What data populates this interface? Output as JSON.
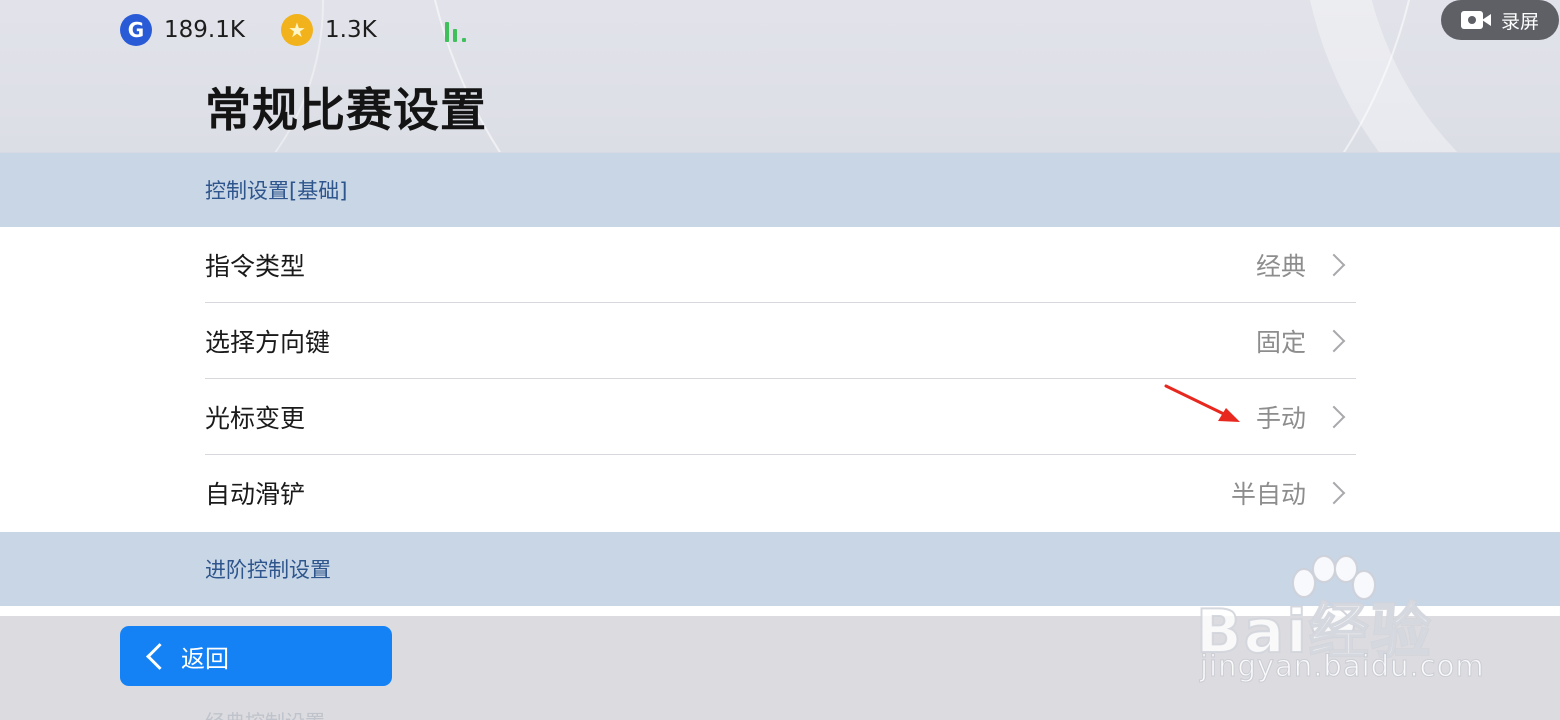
{
  "status_bar": {
    "currency_g_icon": "G",
    "currency_g_value": "189.1K",
    "currency_star_icon": "★",
    "currency_star_value": "1.3K",
    "signal_icon": "signal-bars-icon",
    "record_label": "录屏"
  },
  "page": {
    "title": "常规比赛设置"
  },
  "sections": {
    "basic_header": "控制设置[基础]",
    "advanced_header": "进阶控制设置",
    "classic_header": "经典控制设置"
  },
  "settings": [
    {
      "label": "指令类型",
      "value": "经典"
    },
    {
      "label": "选择方向键",
      "value": "固定"
    },
    {
      "label": "光标变更",
      "value": "手动"
    },
    {
      "label": "自动滑铲",
      "value": "半自动"
    }
  ],
  "footer": {
    "back_label": "返回"
  },
  "watermark": {
    "brand": "Bai经验",
    "url": "jingyan.baidu.com"
  },
  "colors": {
    "accent_blue": "#1482f5",
    "section_bg": "#c8d6e6",
    "section_text": "#2e558c",
    "annotation_red": "#e8281e"
  }
}
